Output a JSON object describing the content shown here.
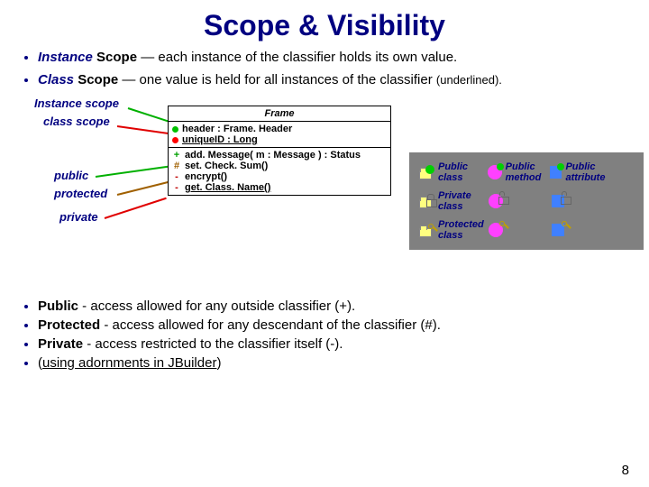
{
  "title": "Scope & Visibility",
  "bullets_top": [
    {
      "em": "Instance",
      "norm": " Scope",
      "rest": " — each instance of the classifier holds its own value."
    },
    {
      "em": "Class",
      "norm": " Scope",
      "rest": " — one value is held for all instances of the classifier ",
      "small": "(underlined)."
    }
  ],
  "side_labels": {
    "instance": "Instance scope",
    "class": "class scope",
    "public": "public",
    "protected": "protected",
    "private": "private"
  },
  "uml": {
    "name": "Frame",
    "attrs": [
      {
        "dot": "#00c000",
        "text": "header : Frame. Header"
      },
      {
        "dot": "#ff0000",
        "text": "uniqueID : Long",
        "underline": true
      }
    ],
    "ops": [
      {
        "vis": "+",
        "vcol": "#00a000",
        "text": "add. Message( m : Message ) : Status"
      },
      {
        "vis": "#",
        "vcol": "#a06000",
        "text": "set. Check. Sum()"
      },
      {
        "vis": "-",
        "vcol": "#c00000",
        "text": "encrypt()"
      },
      {
        "vis": "-",
        "vcol": "#c00000",
        "text": "get. Class. Name()",
        "underline": true
      }
    ]
  },
  "legend": {
    "pub_class": "Public class",
    "pub_method": "Public method",
    "pub_attr": "Public attribute",
    "priv_class": "Private class",
    "prot_class": "Protected class"
  },
  "bullets_bot": [
    {
      "b": "Public",
      "rest": " - access allowed for any outside classifier (+)."
    },
    {
      "b": "Protected",
      "rest": " - access allowed for any descendant of the classifier (#)."
    },
    {
      "b": "Private",
      "rest": " - access restricted to the classifier itself (-)."
    },
    {
      "link": "using adornments in JBuilder",
      "pre": "(",
      "post": ")"
    }
  ],
  "page": "8",
  "chart_data": {
    "type": "diagram",
    "title": "Scope & Visibility",
    "uml_class": {
      "name": "Frame",
      "attributes": [
        {
          "scope": "instance",
          "name": "header",
          "type": "Frame.Header"
        },
        {
          "scope": "class",
          "name": "uniqueID",
          "type": "Long"
        }
      ],
      "operations": [
        {
          "visibility": "public",
          "symbol": "+",
          "signature": "addMessage( m : Message ) : Status"
        },
        {
          "visibility": "protected",
          "symbol": "#",
          "signature": "setCheckSum()"
        },
        {
          "visibility": "private",
          "symbol": "-",
          "signature": "encrypt()"
        },
        {
          "visibility": "private",
          "symbol": "-",
          "scope": "class",
          "signature": "getClassName()"
        }
      ]
    },
    "visibility_rules": [
      {
        "name": "Public",
        "symbol": "+",
        "rule": "access allowed for any outside classifier"
      },
      {
        "name": "Protected",
        "symbol": "#",
        "rule": "access allowed for any descendant of the classifier"
      },
      {
        "name": "Private",
        "symbol": "-",
        "rule": "access restricted to the classifier itself"
      }
    ],
    "legend_icons": [
      "Public class",
      "Public method",
      "Public attribute",
      "Private class",
      "Protected class"
    ]
  }
}
